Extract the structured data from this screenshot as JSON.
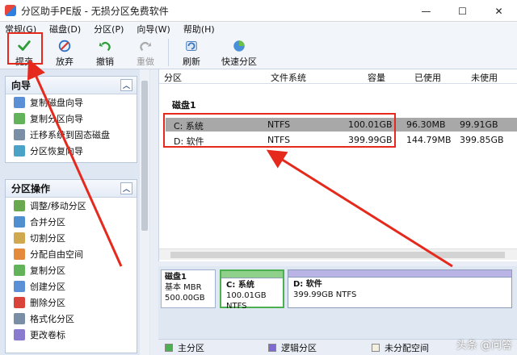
{
  "window": {
    "title": "分区助手PE版 - 无损分区免费软件",
    "min": "—",
    "max": "☐",
    "close": "✕"
  },
  "menu": [
    "常规(G)",
    "磁盘(D)",
    "分区(P)",
    "向导(W)",
    "帮助(H)"
  ],
  "toolbar": {
    "submit": "提交",
    "discard": "放弃",
    "undo": "撤销",
    "redo": "重做",
    "refresh": "刷新",
    "quick_partition": "快速分区"
  },
  "wizard_panel": {
    "title": "向导",
    "items": [
      "复制磁盘向导",
      "复制分区向导",
      "迁移系统到固态磁盘",
      "分区恢复向导"
    ]
  },
  "ops_panel": {
    "title": "分区操作",
    "items": [
      "调整/移动分区",
      "合并分区",
      "切割分区",
      "分配自由空间",
      "复制分区",
      "创建分区",
      "删除分区",
      "格式化分区",
      "更改卷标"
    ]
  },
  "table": {
    "headers": [
      "分区",
      "文件系统",
      "容量",
      "已使用",
      "未使用"
    ],
    "disk_label": "磁盘1",
    "rows": [
      {
        "name": "C: 系统",
        "fs": "NTFS",
        "cap": "100.01GB",
        "used": "96.30MB",
        "free": "99.91GB"
      },
      {
        "name": "D: 软件",
        "fs": "NTFS",
        "cap": "399.99GB",
        "used": "144.79MB",
        "free": "399.85GB"
      }
    ]
  },
  "diskmap": {
    "disk": {
      "name": "磁盘1",
      "type": "基本 MBR",
      "size": "500.00GB"
    },
    "parts": [
      {
        "name": "C: 系统",
        "detail": "100.01GB NTFS"
      },
      {
        "name": "D: 软件",
        "detail": "399.99GB NTFS"
      }
    ]
  },
  "legend": [
    "主分区",
    "逻辑分区",
    "未分配空间"
  ],
  "colors": {
    "primary": "#4caf50",
    "logical": "#7d6bd0",
    "unallocated": "#f3f0e0",
    "annotation": "#e52a1d"
  },
  "watermark": "头条 @问答"
}
